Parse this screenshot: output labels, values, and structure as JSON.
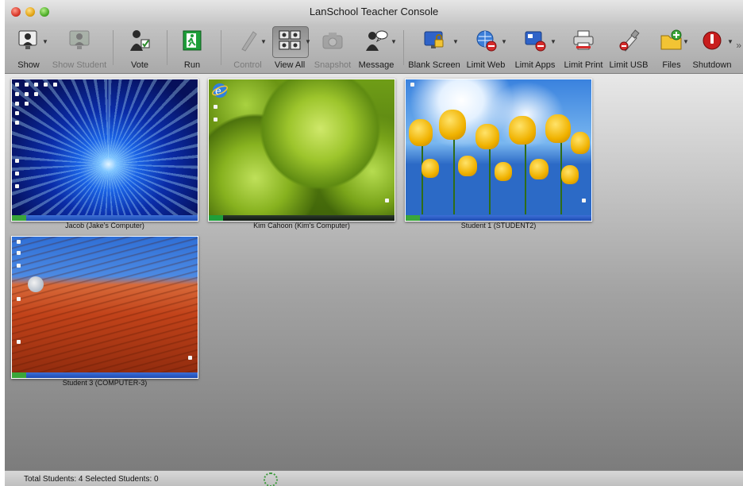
{
  "window": {
    "title": "LanSchool Teacher Console"
  },
  "toolbar": {
    "buttons": [
      {
        "label": "Show",
        "icon": "teacher-screen-icon",
        "has_menu": true,
        "enabled": true
      },
      {
        "label": "Show Student",
        "icon": "student-screen-icon",
        "has_menu": false,
        "enabled": false
      },
      {
        "label": "Vote",
        "icon": "vote-icon",
        "has_menu": false,
        "enabled": true
      },
      {
        "label": "Run",
        "icon": "run-exit-icon",
        "has_menu": false,
        "enabled": true
      },
      {
        "label": "Control",
        "icon": "control-pen-icon",
        "has_menu": true,
        "enabled": false
      },
      {
        "label": "View All",
        "icon": "view-all-grid-icon",
        "has_menu": true,
        "enabled": true,
        "active": true
      },
      {
        "label": "Snapshot",
        "icon": "camera-icon",
        "has_menu": false,
        "enabled": false
      },
      {
        "label": "Message",
        "icon": "message-icon",
        "has_menu": true,
        "enabled": true
      },
      {
        "label": "Blank Screen",
        "icon": "blank-screen-lock-icon",
        "has_menu": true,
        "enabled": true
      },
      {
        "label": "Limit Web",
        "icon": "limit-web-globe-icon",
        "has_menu": true,
        "enabled": true
      },
      {
        "label": "Limit Apps",
        "icon": "limit-apps-icon",
        "has_menu": true,
        "enabled": true
      },
      {
        "label": "Limit Print",
        "icon": "printer-icon",
        "has_menu": false,
        "enabled": true
      },
      {
        "label": "Limit USB",
        "icon": "usb-icon",
        "has_menu": false,
        "enabled": true
      },
      {
        "label": "Files",
        "icon": "folder-icon",
        "has_menu": true,
        "enabled": true
      },
      {
        "label": "Shutdown",
        "icon": "shutdown-icon",
        "has_menu": true,
        "enabled": true
      }
    ]
  },
  "students": [
    {
      "caption": "Jacob (Jake's Computer)",
      "wallpaper": "blue-burst"
    },
    {
      "caption": "Kim Cahoon (Kim's Computer)",
      "wallpaper": "green-succulent"
    },
    {
      "caption": "Student 1 (STUDENT2)",
      "wallpaper": "yellow-tulips"
    },
    {
      "caption": "Student 3 (COMPUTER-3)",
      "wallpaper": "red-desert"
    }
  ],
  "status": {
    "text": "Total Students: 4  Selected Students: 0"
  },
  "colors": {
    "toolbar_bg": "#b5b5b5",
    "taskbar_blue": "#2a5cc4",
    "accent_green": "#3f9a3f"
  }
}
